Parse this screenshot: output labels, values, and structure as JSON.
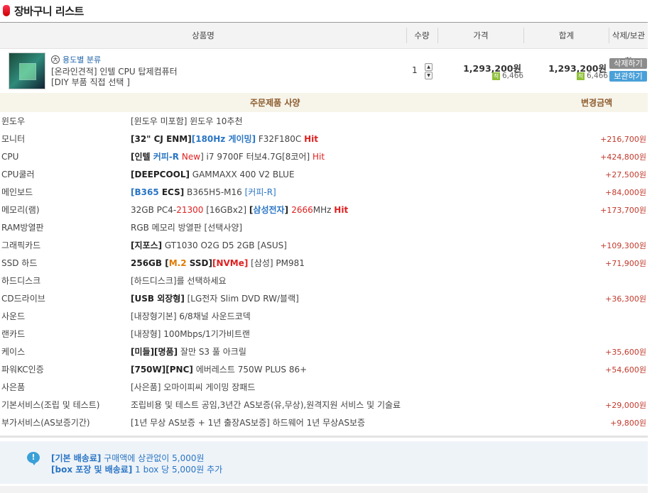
{
  "title": "장바구니 리스트",
  "header": {
    "product": "상품명",
    "qty": "수량",
    "price": "가격",
    "total": "합계",
    "action": "삭제/보관함"
  },
  "item": {
    "category": "용도별 분류",
    "category_icon": "大",
    "name1": "[온라인견적] 인텔 CPU 탑제컴퓨터",
    "name2": "[DIY 부품 직접 선택 ]",
    "qty": "1",
    "price": "1,293,200원",
    "price_points": "6,466",
    "total": "1,293,200원",
    "total_points": "6,466",
    "points_icon": "적",
    "delete_label": "삭제하기",
    "keep_label": "보관하기"
  },
  "spec": {
    "col_title": "주문제품 사양",
    "col_amount": "변경금액",
    "rows": [
      {
        "label": "윈도우",
        "amount": ""
      },
      {
        "label": "모니터",
        "amount": "+216,700원"
      },
      {
        "label": "CPU",
        "amount": "+424,800원"
      },
      {
        "label": "CPU쿨러",
        "amount": "+27,500원"
      },
      {
        "label": "메인보드",
        "amount": "+84,000원"
      },
      {
        "label": "메모리(램)",
        "amount": "+173,700원"
      },
      {
        "label": "RAM방열판",
        "amount": ""
      },
      {
        "label": "그래픽카드",
        "amount": "+109,300원"
      },
      {
        "label": "SSD 하드",
        "amount": "+71,900원"
      },
      {
        "label": "하드디스크",
        "amount": ""
      },
      {
        "label": "CD드라이브",
        "amount": "+36,300원"
      },
      {
        "label": "사운드",
        "amount": ""
      },
      {
        "label": "랜카드",
        "amount": ""
      },
      {
        "label": "케이스",
        "amount": "+35,600원"
      },
      {
        "label": "파워KC인증",
        "amount": "+54,600원"
      },
      {
        "label": "사은품",
        "amount": ""
      },
      {
        "label": "기본서비스(조립 및 테스트)",
        "amount": "+29,000원"
      },
      {
        "label": "부가서비스(AS보증기간)",
        "amount": "+9,800원"
      }
    ],
    "v": {
      "r0": [
        "[윈도우 미포함] 윈도우 10추천"
      ],
      "r1": [
        "[32\" CJ ENM]",
        "[180Hz 게이밍]",
        " F32F180C ",
        "Hit"
      ],
      "r2": [
        "[인텔 ",
        "커피-R",
        " New",
        "] i7 9700F 터보4.7G[8코어] ",
        "Hit"
      ],
      "r3": [
        "[DEEPCOOL]",
        " GAMMAXX 400 V2 BLUE"
      ],
      "r4": [
        "[B365 ",
        "ECS]",
        " B365H5-M16 ",
        "[커피-R]"
      ],
      "r5": [
        "32GB PC4-",
        "21300",
        " [16GBx2] ",
        "[",
        "삼성전자",
        "] ",
        "2666",
        "MHz ",
        "Hit"
      ],
      "r6": [
        "RGB 메모리 방열판 [선택사양]"
      ],
      "r7": [
        "[지포스]",
        " GT1030 O2G D5 2GB [ASUS]"
      ],
      "r8": [
        "256GB ",
        "[",
        "M.2",
        " SSD]",
        "[NVMe]",
        " [삼성] PM981"
      ],
      "r9": [
        "[하드디스크]를 선택하세요"
      ],
      "r10": [
        "[USB 외장형]",
        " [LG전자 Slim DVD RW/블랙]"
      ],
      "r11": [
        "[내장형기본] 6/8채널 사운드코덱"
      ],
      "r12": [
        "[내장형] 100Mbps/1기가비트랜"
      ],
      "r13": [
        "[미들][명품]",
        " 잘만 S3 풀 아크릴"
      ],
      "r14": [
        "[750W][PNC]",
        " 에버레스트 750W PLUS 86+"
      ],
      "r15": [
        "[사은품] 오마이피씨 게이밍 장패드"
      ],
      "r16": [
        "조립비용 및 테스트 공임,3년간 AS보증(유,무상),원격지원 서비스 및 기술료"
      ],
      "r17": [
        "[1년 무상 AS보증 + 1년 출장AS보증] 하드웨어 1년 무상AS보증"
      ]
    }
  },
  "shipping": {
    "icon": "!",
    "line1_key": "[기본 배송료]",
    "line1_val": " 구매액에 상관없이 5,000원",
    "line2_key": "[box 포장 및 배송료]",
    "line2_val": " 1 box 당 5,000원 추가"
  }
}
